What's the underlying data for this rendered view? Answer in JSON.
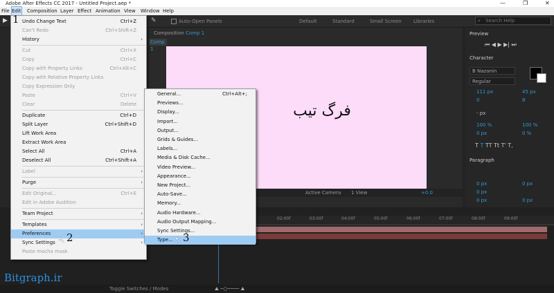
{
  "window": {
    "title": "Adobe After Effects CC 2017 - Untitled Project.aep *"
  },
  "menubar": [
    "File",
    "Edit",
    "Composition",
    "Layer",
    "Effect",
    "Animation",
    "View",
    "Window",
    "Help"
  ],
  "toolbar": {
    "auto_open": "Auto-Open Panels",
    "workspaces": [
      "Default",
      "Standard",
      "Small Screen",
      "Libraries"
    ],
    "search_placeholder": "Search Help"
  },
  "composition": {
    "tab": "Composition",
    "comp_name": "Comp 1",
    "comp_tab": "Comp 1",
    "text": "فرگ تیب",
    "camera": "Active Camera",
    "view": "1 View",
    "exposure": "+0.0"
  },
  "edit_menu": [
    {
      "label": "Undo Change Text",
      "shortcut": "Ctrl+Z",
      "enabled": true
    },
    {
      "label": "Can't Redo",
      "shortcut": "Ctrl+Shift+Z",
      "enabled": false
    },
    {
      "label": "History",
      "shortcut": "",
      "enabled": true,
      "submenu": true
    },
    {
      "sep": true
    },
    {
      "label": "Cut",
      "shortcut": "Ctrl+X",
      "enabled": false
    },
    {
      "label": "Copy",
      "shortcut": "Ctrl+C",
      "enabled": false
    },
    {
      "label": "Copy with Property Links",
      "shortcut": "Ctrl+Alt+C",
      "enabled": false
    },
    {
      "label": "Copy with Relative Property Links",
      "shortcut": "",
      "enabled": false
    },
    {
      "label": "Copy Expression Only",
      "shortcut": "",
      "enabled": false
    },
    {
      "label": "Paste",
      "shortcut": "Ctrl+V",
      "enabled": false
    },
    {
      "label": "Clear",
      "shortcut": "Delete",
      "enabled": false
    },
    {
      "sep": true
    },
    {
      "label": "Duplicate",
      "shortcut": "Ctrl+D",
      "enabled": true
    },
    {
      "label": "Split Layer",
      "shortcut": "Ctrl+Shift+D",
      "enabled": true
    },
    {
      "label": "Lift Work Area",
      "shortcut": "",
      "enabled": true
    },
    {
      "label": "Extract Work Area",
      "shortcut": "",
      "enabled": true
    },
    {
      "label": "Select All",
      "shortcut": "Ctrl+A",
      "enabled": true
    },
    {
      "label": "Deselect All",
      "shortcut": "Ctrl+Shift+A",
      "enabled": true
    },
    {
      "sep": true
    },
    {
      "label": "Label",
      "shortcut": "",
      "enabled": false,
      "submenu": true
    },
    {
      "sep": true
    },
    {
      "label": "Purge",
      "shortcut": "",
      "enabled": true,
      "submenu": true
    },
    {
      "sep": true
    },
    {
      "label": "Edit Original...",
      "shortcut": "Ctrl+E",
      "enabled": false
    },
    {
      "label": "Edit in Adobe Audition",
      "shortcut": "",
      "enabled": false
    },
    {
      "sep": true
    },
    {
      "label": "Team Project",
      "shortcut": "",
      "enabled": true,
      "submenu": true
    },
    {
      "sep": true
    },
    {
      "label": "Templates",
      "shortcut": "",
      "enabled": true,
      "submenu": true
    },
    {
      "label": "Preferences",
      "shortcut": "",
      "enabled": true,
      "submenu": true,
      "highlight": true
    },
    {
      "label": "Sync Settings",
      "shortcut": "",
      "enabled": true,
      "submenu": true
    },
    {
      "label": "Paste mocha mask",
      "shortcut": "",
      "enabled": false
    }
  ],
  "prefs_menu": [
    {
      "label": "General...",
      "shortcut": "Ctrl+Alt+;"
    },
    {
      "label": "Previews..."
    },
    {
      "label": "Display..."
    },
    {
      "label": "Import..."
    },
    {
      "label": "Output..."
    },
    {
      "label": "Grids & Guides..."
    },
    {
      "label": "Labels..."
    },
    {
      "label": "Media & Disk Cache..."
    },
    {
      "label": "Video Preview..."
    },
    {
      "label": "Appearance..."
    },
    {
      "label": "New Project..."
    },
    {
      "label": "Auto-Save..."
    },
    {
      "label": "Memory..."
    },
    {
      "label": "Audio Hardware..."
    },
    {
      "label": "Audio Output Mapping..."
    },
    {
      "label": "Sync Settings..."
    },
    {
      "label": "Type...",
      "highlight": true
    }
  ],
  "steps": [
    "1",
    "2",
    "3"
  ],
  "right_panel": {
    "preview": "Preview",
    "character": "Character",
    "font": "B Nazanin",
    "style": "Regular",
    "size": "111 px",
    "leading": "45 px",
    "kerning": "0",
    "tracking": "8",
    "scale_v": "100 %",
    "scale_h": "100 %",
    "baseline": "0 px",
    "tsume": "0 %",
    "stroke": "- px",
    "paragraph": "Paragraph",
    "indent1": "0 px",
    "indent2": "0 px",
    "indent3": "0 px",
    "space1": "0 px",
    "space2": "0 px"
  },
  "timeline": {
    "ticks": [
      "02:00f",
      "03:00f",
      "04:00f",
      "05:00f",
      "06:00f",
      "07:00f",
      "08:00f",
      "09:00f"
    ]
  },
  "status": {
    "toggle": "Toggle Switches / Modes"
  },
  "watermark": "Bitgraph.ir"
}
